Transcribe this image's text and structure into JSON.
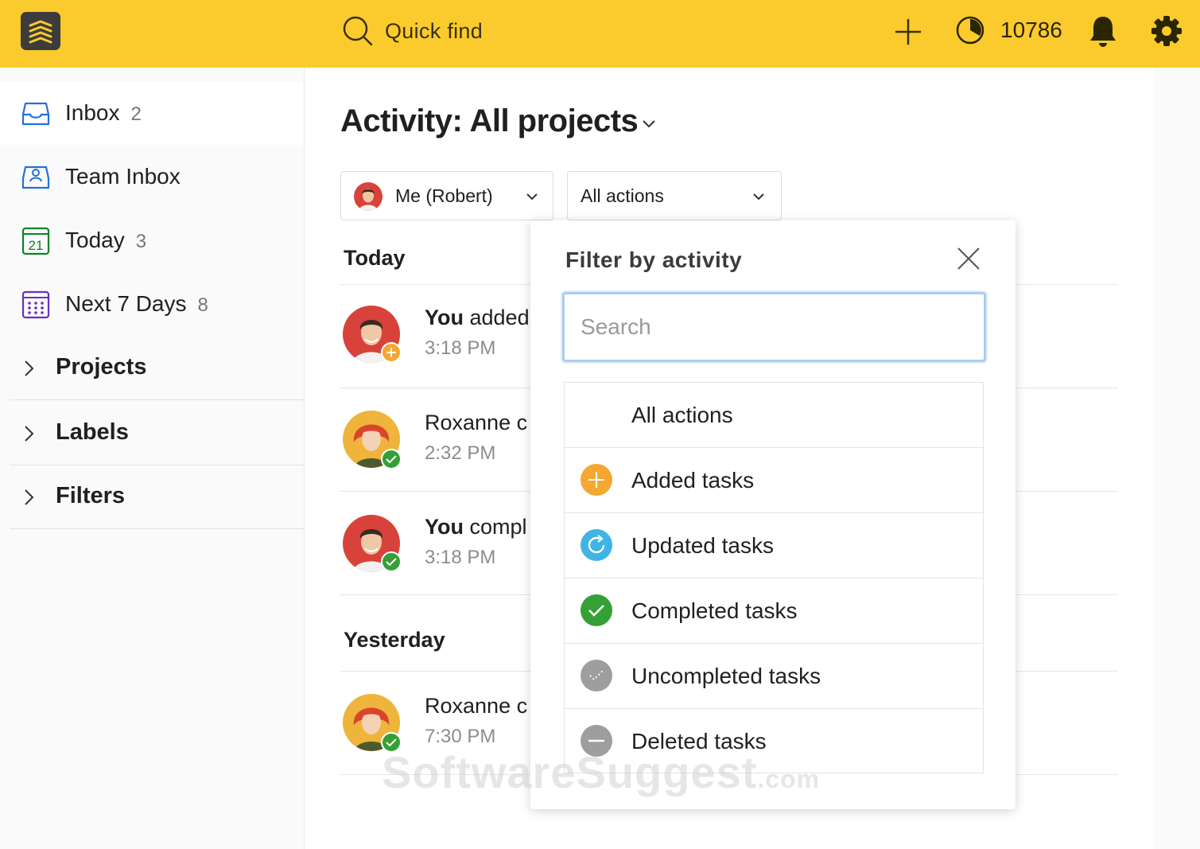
{
  "app": {
    "quick_find": "Quick find",
    "karma": "10786",
    "brand_color": "#fbca2c"
  },
  "sidebar": {
    "items": [
      {
        "label": "Inbox",
        "count": "2",
        "icon": "inbox-icon"
      },
      {
        "label": "Team Inbox",
        "count": "",
        "icon": "team-inbox-icon"
      },
      {
        "label": "Today",
        "count": "3",
        "icon": "calendar-today-icon",
        "icon_text": "21"
      },
      {
        "label": "Next 7 Days",
        "count": "8",
        "icon": "calendar-week-icon"
      }
    ],
    "sections": [
      {
        "label": "Projects"
      },
      {
        "label": "Labels"
      },
      {
        "label": "Filters"
      }
    ]
  },
  "main": {
    "title": "Activity: All projects",
    "filters": {
      "user": "Me (Robert)",
      "action": "All actions"
    },
    "groups": [
      {
        "heading": "Today",
        "entries": [
          {
            "actor": "You",
            "text": " added",
            "time": "3:18 PM",
            "avatar": "robert",
            "badge": "added"
          },
          {
            "actor": "",
            "text": "Roxanne c",
            "time": "2:32 PM",
            "avatar": "roxanne",
            "badge": "completed"
          },
          {
            "actor": "You",
            "text": " compl",
            "time": "3:18 PM",
            "avatar": "robert",
            "badge": "completed"
          }
        ]
      },
      {
        "heading": "Yesterday",
        "entries": [
          {
            "actor": "",
            "text": "Roxanne c",
            "time": "7:30 PM",
            "avatar": "roxanne",
            "badge": "completed"
          }
        ]
      }
    ]
  },
  "popover": {
    "title": "Filter by activity",
    "search_placeholder": "Search",
    "options": [
      {
        "label": "All actions",
        "icon": "none"
      },
      {
        "label": "Added tasks",
        "icon": "plus-circle-icon",
        "color": "#f4a731"
      },
      {
        "label": "Updated tasks",
        "icon": "refresh-circle-icon",
        "color": "#3fb4e5"
      },
      {
        "label": "Completed tasks",
        "icon": "check-circle-icon",
        "color": "#34a036"
      },
      {
        "label": "Uncompleted tasks",
        "icon": "uncheck-circle-icon",
        "color": "#9e9e9e"
      },
      {
        "label": "Deleted tasks",
        "icon": "minus-circle-icon",
        "color": "#9e9e9e"
      }
    ]
  },
  "watermark": {
    "main": "SoftwareSuggest",
    "suffix": ".com"
  }
}
